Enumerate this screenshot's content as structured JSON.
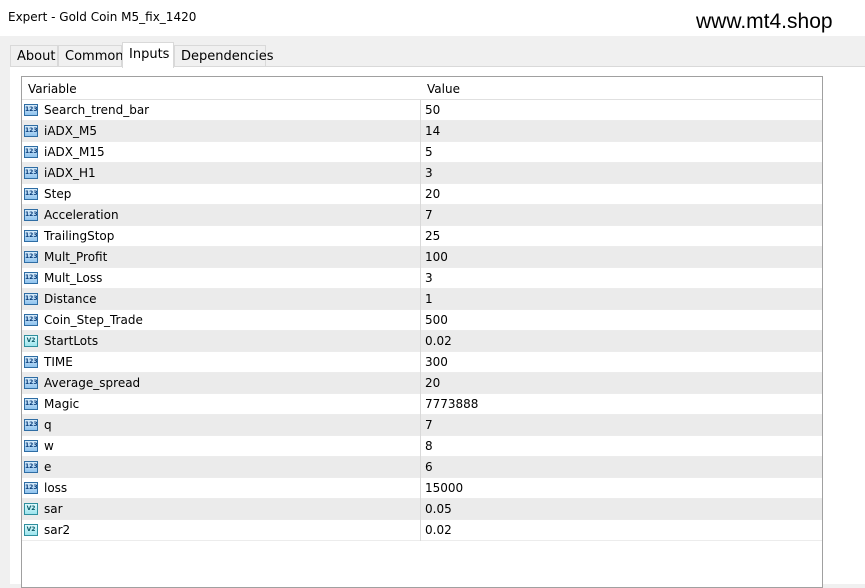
{
  "window": {
    "title": "Expert - Gold Coin M5_fix_1420",
    "watermark": "www.mt4.shop"
  },
  "tabs": [
    "About",
    "Common",
    "Inputs",
    "Dependencies"
  ],
  "active_tab": "Inputs",
  "grid": {
    "headers": {
      "variable": "Variable",
      "value": "Value"
    },
    "rows": [
      {
        "name": "Search_trend_bar",
        "value": "50",
        "icon": "int-icon",
        "icon_text": "123"
      },
      {
        "name": "iADX_M5",
        "value": "14",
        "icon": "int-icon",
        "icon_text": "123"
      },
      {
        "name": "iADX_M15",
        "value": "5",
        "icon": "int-icon",
        "icon_text": "123"
      },
      {
        "name": "iADX_H1",
        "value": "3",
        "icon": "int-icon",
        "icon_text": "123"
      },
      {
        "name": "Step",
        "value": "20",
        "icon": "int-icon",
        "icon_text": "123"
      },
      {
        "name": "Acceleration",
        "value": "7",
        "icon": "int-icon",
        "icon_text": "123"
      },
      {
        "name": "TrailingStop",
        "value": "25",
        "icon": "int-icon",
        "icon_text": "123"
      },
      {
        "name": "Mult_Profit",
        "value": "100",
        "icon": "int-icon",
        "icon_text": "123"
      },
      {
        "name": "Mult_Loss",
        "value": "3",
        "icon": "int-icon",
        "icon_text": "123"
      },
      {
        "name": "Distance",
        "value": "1",
        "icon": "int-icon",
        "icon_text": "123"
      },
      {
        "name": "Coin_Step_Trade",
        "value": "500",
        "icon": "int-icon",
        "icon_text": "123"
      },
      {
        "name": "StartLots",
        "value": "0.02",
        "icon": "double-icon",
        "icon_text": "V2"
      },
      {
        "name": "TIME",
        "value": "300",
        "icon": "int-icon",
        "icon_text": "123"
      },
      {
        "name": "Average_spread",
        "value": "20",
        "icon": "int-icon",
        "icon_text": "123"
      },
      {
        "name": "Magic",
        "value": "7773888",
        "icon": "int-icon",
        "icon_text": "123"
      },
      {
        "name": "q",
        "value": "7",
        "icon": "int-icon",
        "icon_text": "123"
      },
      {
        "name": "w",
        "value": "8",
        "icon": "int-icon",
        "icon_text": "123"
      },
      {
        "name": "e",
        "value": "6",
        "icon": "int-icon",
        "icon_text": "123"
      },
      {
        "name": "loss",
        "value": "15000",
        "icon": "int-icon",
        "icon_text": "123"
      },
      {
        "name": "sar",
        "value": "0.05",
        "icon": "double-icon",
        "icon_text": "V2"
      },
      {
        "name": "sar2",
        "value": "0.02",
        "icon": "double-icon",
        "icon_text": "V2"
      }
    ]
  }
}
